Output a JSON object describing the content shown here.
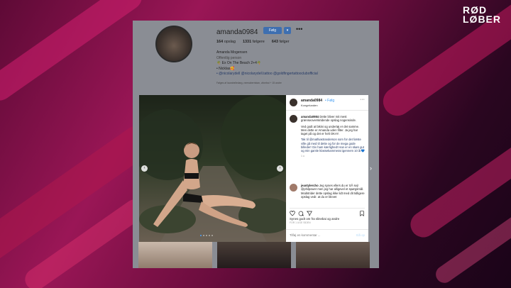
{
  "logo": {
    "line1": "RØD",
    "line2": "LØBER"
  },
  "profile": {
    "username": "amanda0984",
    "follow_label": "Følg",
    "stats": [
      {
        "count": "164",
        "label": "opslag"
      },
      {
        "count": "1331",
        "label": "følgere"
      },
      {
        "count": "643",
        "label": "følger"
      }
    ],
    "bio": {
      "name": "Amanda Mogensen",
      "category": "Offentlig person",
      "line1": "🌴 Ex On The Beach 2+4🌴",
      "line2": "• Nicklas🥰",
      "line3": "• @nicolarydell @nicolarydell.tattoo @goldfingertattooclubofficial"
    },
    "followed_by": "Følges af laurahelledarg, neenaberristan, zlinebai + 15 andre"
  },
  "post": {
    "username": "amanda0984",
    "follow": "Følg",
    "location": "Kongelunden",
    "caption_user": "amanda0984",
    "caption_p1": "Dette bliver mit mest grænseoverskridende opslag nogensinde.",
    "caption_p2": "Ved godt at bikini og undertøj er det samme. Men dette er Amanda uden filter. Ja jeg har taget på og det er helt OKAY.",
    "caption_p3": "Tak til @mathiastranderson som for det første ville gå med til dette og for de mega gode billeder! Giv ham kærlighed! Han er en skøn gut og min gamle klassekammerat igennem 10 år💙",
    "caption_ago": "1 u",
    "comment_user": "jeantylercho",
    "comment_text": "Jeg synes ellers du er SÅ sej! @philpower men jeg har alligevel et spørgsmål. Modstrider dette opslag ikke lidt med dit tidligere opslag vedr. at du er blevet",
    "likes": "Synes godt om fra slinebai og andre",
    "date": "FOR 1 UGE SIDEN",
    "comment_placeholder": "Tilføj en kommentar ...",
    "post_label": "Slå op"
  }
}
